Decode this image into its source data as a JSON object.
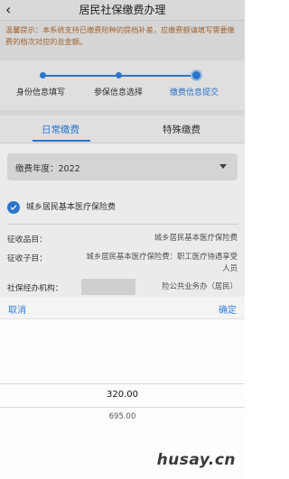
{
  "header": {
    "back_icon": "chevron-left-icon",
    "title": "居民社保缴费办理"
  },
  "notice": {
    "text": "温馨提示：本系统支持已缴费险种的提档补差，应缴费额请填写需要缴费的档次对应的总金额。"
  },
  "steps": [
    {
      "label": "身份信息填写",
      "state": "done"
    },
    {
      "label": "参保信息选择",
      "state": "done"
    },
    {
      "label": "缴费信息提交",
      "state": "active"
    }
  ],
  "tabs": [
    {
      "label": "日常缴费",
      "active": true
    },
    {
      "label": "特殊缴费",
      "active": false
    }
  ],
  "payment_year": {
    "label": "缴费年度：2022"
  },
  "insurance": {
    "label": "城乡居民基本医疗保险费",
    "checked": true
  },
  "details": {
    "item_label": "征收品目：",
    "item_value": "城乡居民基本医疗保险费",
    "subitem_label": "征收子目：",
    "subitem_value_line1": "城乡居民基本医疗保险费：职工医疗待遇享受",
    "subitem_value_line2": "人员",
    "agency_label": "社保经办机构：",
    "agency_value": "险公共业务办（居民）"
  },
  "picker": {
    "cancel": "取消",
    "confirm": "确定",
    "selected": "320.00",
    "next": "695.00"
  },
  "watermark": "husay.cn",
  "colors": {
    "accent": "#2f7fd9",
    "notice_text": "#b06b32"
  }
}
